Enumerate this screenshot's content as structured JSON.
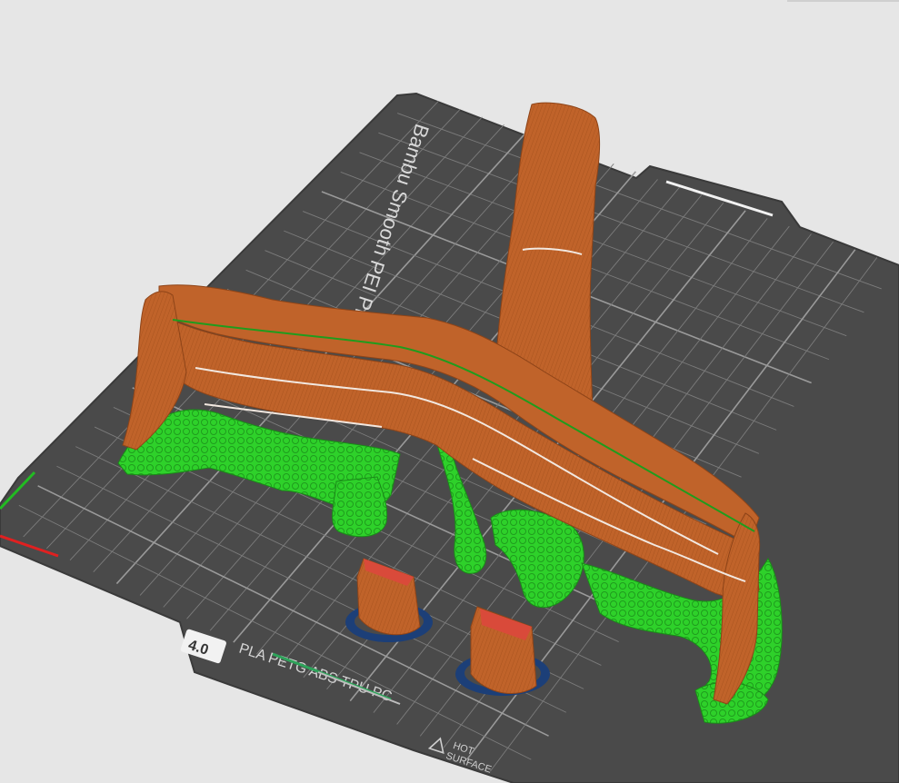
{
  "app": {
    "view": "3D slice preview"
  },
  "plate": {
    "brand_text": "Bambu Smooth PEI Plate",
    "filament_text": "PLA PETG ABS TPU PC",
    "badge_text": "4.0",
    "warning_line1": "HOT",
    "warning_line2": "SURFACE",
    "warning_icon": "warning-triangle-icon"
  },
  "colors": {
    "background": "#e6e6e6",
    "plate": "#4a4a4a",
    "grid": "#8c8c8c",
    "model": "#c0632a",
    "model_dark": "#8e4418",
    "support": "#2ed12a",
    "support_dark": "#1f9c1d",
    "brim": "#1c3f78",
    "axis_x": "#e02020",
    "axis_y": "#22bb22"
  }
}
